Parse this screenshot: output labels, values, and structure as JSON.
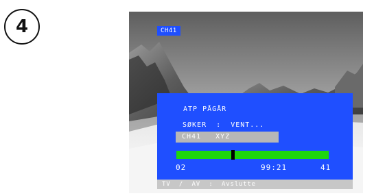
{
  "step": {
    "number": "4"
  },
  "tv": {
    "channel_tag": "CH41",
    "osd": {
      "title": "ATP PÅGÅR",
      "search_status": "SØKER  :  VENT...",
      "channel_line": "CH41   XYZ",
      "progress": {
        "fraction": 0.37
      },
      "start_number": "02",
      "middle_number": "99:21",
      "end_number": "41"
    },
    "footer": "TV  /  AV  :  Avslutte"
  },
  "colors": {
    "osd_blue": "#1f4fff",
    "progress_green": "#1ed60c",
    "channel_box_grey": "#b7b7b7"
  }
}
